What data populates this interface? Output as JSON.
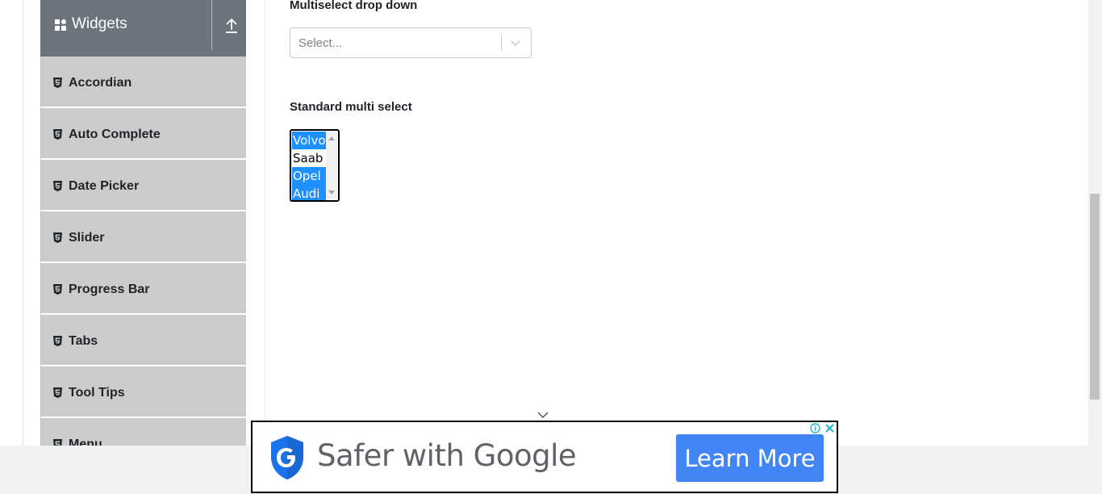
{
  "sidebar": {
    "group": {
      "title": "Widgets",
      "icon": "grid-icon",
      "toggle_icon": "arrow-up-icon"
    },
    "items": [
      {
        "label": "Accordian",
        "icon": "html5-icon"
      },
      {
        "label": "Auto Complete",
        "icon": "html5-icon"
      },
      {
        "label": "Date Picker",
        "icon": "html5-icon"
      },
      {
        "label": "Slider",
        "icon": "html5-icon"
      },
      {
        "label": "Progress Bar",
        "icon": "html5-icon"
      },
      {
        "label": "Tabs",
        "icon": "html5-icon"
      },
      {
        "label": "Tool Tips",
        "icon": "html5-icon"
      },
      {
        "label": "Menu",
        "icon": "html5-icon"
      }
    ]
  },
  "main": {
    "multiselect": {
      "label": "Multiselect drop down",
      "placeholder": "Select..."
    },
    "standard_multiselect": {
      "label": "Standard multi select",
      "options": [
        {
          "label": "Volvo",
          "selected": true
        },
        {
          "label": "Saab",
          "selected": false
        },
        {
          "label": "Opel",
          "selected": true
        },
        {
          "label": "Audi",
          "selected": true
        }
      ]
    }
  },
  "ad": {
    "brand_text": "Safer with Google",
    "cta_label": "Learn More",
    "info_icon": "info-icon",
    "close_icon": "close-icon"
  },
  "colors": {
    "sidebar_header": "#6c757d",
    "sidebar_item": "#cccccc",
    "selected_option": "#1e90ff",
    "ad_button": "#4285f4"
  }
}
